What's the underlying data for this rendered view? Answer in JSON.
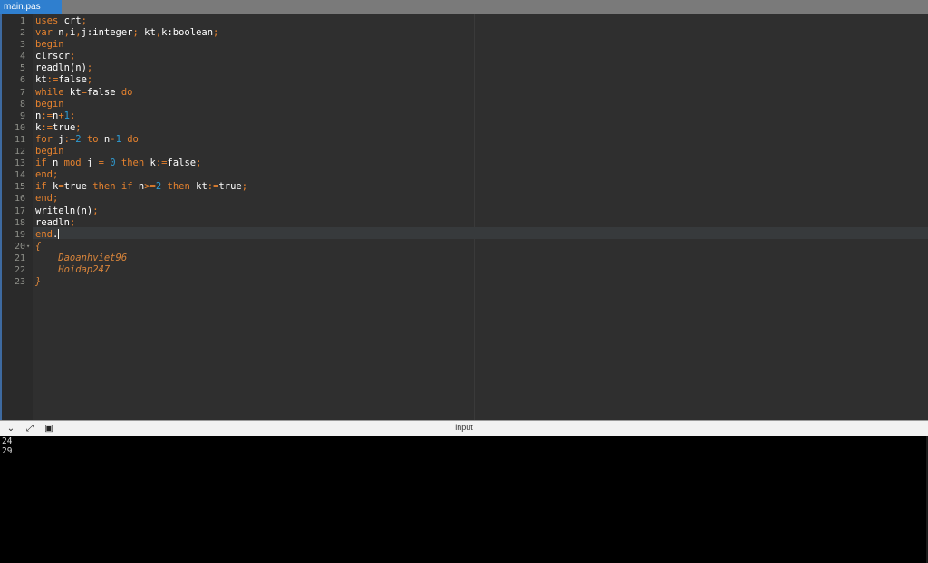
{
  "tab": {
    "filename": "main.pas"
  },
  "editor": {
    "lines": [
      [
        [
          "kw",
          "uses"
        ],
        [
          "plain",
          " crt"
        ],
        [
          "op",
          ";"
        ]
      ],
      [
        [
          "kw",
          "var"
        ],
        [
          "plain",
          " n"
        ],
        [
          "op",
          ","
        ],
        [
          "plain",
          "i"
        ],
        [
          "op",
          ","
        ],
        [
          "plain",
          "j:integer"
        ],
        [
          "op",
          ";"
        ],
        [
          "plain",
          " kt"
        ],
        [
          "op",
          ","
        ],
        [
          "plain",
          "k:boolean"
        ],
        [
          "op",
          ";"
        ]
      ],
      [
        [
          "kw",
          "begin"
        ]
      ],
      [
        [
          "plain",
          "clrscr"
        ],
        [
          "op",
          ";"
        ]
      ],
      [
        [
          "plain",
          "readln(n)"
        ],
        [
          "op",
          ";"
        ]
      ],
      [
        [
          "plain",
          "kt"
        ],
        [
          "op",
          ":="
        ],
        [
          "plain",
          "false"
        ],
        [
          "op",
          ";"
        ]
      ],
      [
        [
          "kw",
          "while"
        ],
        [
          "plain",
          " kt"
        ],
        [
          "op",
          "="
        ],
        [
          "plain",
          "false "
        ],
        [
          "kw",
          "do"
        ]
      ],
      [
        [
          "kw",
          "begin"
        ]
      ],
      [
        [
          "plain",
          "n"
        ],
        [
          "op",
          ":="
        ],
        [
          "plain",
          "n"
        ],
        [
          "op",
          "+"
        ],
        [
          "num",
          "1"
        ],
        [
          "op",
          ";"
        ]
      ],
      [
        [
          "plain",
          "k"
        ],
        [
          "op",
          ":="
        ],
        [
          "plain",
          "true"
        ],
        [
          "op",
          ";"
        ]
      ],
      [
        [
          "kw",
          "for"
        ],
        [
          "plain",
          " j"
        ],
        [
          "op",
          ":="
        ],
        [
          "num",
          "2"
        ],
        [
          "plain",
          " "
        ],
        [
          "kw",
          "to"
        ],
        [
          "plain",
          " n"
        ],
        [
          "op",
          "-"
        ],
        [
          "num",
          "1"
        ],
        [
          "plain",
          " "
        ],
        [
          "kw",
          "do"
        ]
      ],
      [
        [
          "kw",
          "begin"
        ]
      ],
      [
        [
          "kw",
          "if"
        ],
        [
          "plain",
          " n "
        ],
        [
          "kw",
          "mod"
        ],
        [
          "plain",
          " j "
        ],
        [
          "op",
          "="
        ],
        [
          "plain",
          " "
        ],
        [
          "num",
          "0"
        ],
        [
          "plain",
          " "
        ],
        [
          "kw",
          "then"
        ],
        [
          "plain",
          " k"
        ],
        [
          "op",
          ":="
        ],
        [
          "plain",
          "false"
        ],
        [
          "op",
          ";"
        ]
      ],
      [
        [
          "kw",
          "end"
        ],
        [
          "op",
          ";"
        ]
      ],
      [
        [
          "kw",
          "if"
        ],
        [
          "plain",
          " k"
        ],
        [
          "op",
          "="
        ],
        [
          "plain",
          "true "
        ],
        [
          "kw",
          "then"
        ],
        [
          "plain",
          " "
        ],
        [
          "kw",
          "if"
        ],
        [
          "plain",
          " n"
        ],
        [
          "op",
          ">="
        ],
        [
          "num",
          "2"
        ],
        [
          "plain",
          " "
        ],
        [
          "kw",
          "then"
        ],
        [
          "plain",
          " kt"
        ],
        [
          "op",
          ":="
        ],
        [
          "plain",
          "true"
        ],
        [
          "op",
          ";"
        ]
      ],
      [
        [
          "kw",
          "end"
        ],
        [
          "op",
          ";"
        ]
      ],
      [
        [
          "plain",
          "writeln(n)"
        ],
        [
          "op",
          ";"
        ]
      ],
      [
        [
          "plain",
          "readln"
        ],
        [
          "op",
          ";"
        ]
      ],
      [
        [
          "kw",
          "end"
        ],
        [
          "plain",
          "."
        ]
      ],
      [
        [
          "cm",
          "{"
        ]
      ],
      [
        [
          "cm",
          "    Daoanhviet96"
        ]
      ],
      [
        [
          "cm",
          "    Hoidap247"
        ]
      ],
      [
        [
          "cm",
          "}"
        ]
      ]
    ],
    "fold_line": 20,
    "cursor_line": 19
  },
  "panel": {
    "title": "input",
    "buttons": [
      {
        "icon": "chevron-down-icon",
        "glyph": "⌄"
      },
      {
        "icon": "expand-icon",
        "glyph": "⤢"
      },
      {
        "icon": "clipboard-icon",
        "glyph": "📋"
      }
    ]
  },
  "console": {
    "lines": [
      "24",
      "29"
    ]
  }
}
